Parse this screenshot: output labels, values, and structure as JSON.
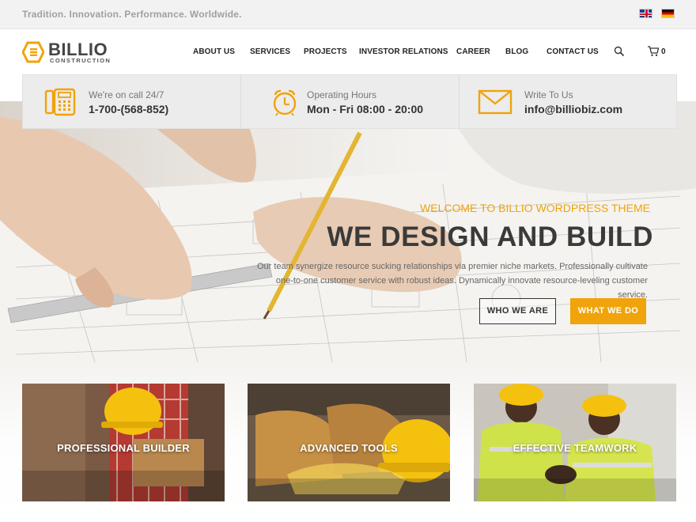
{
  "topbar": {
    "tagline": "Tradition. Innovation. Performance. Worldwide.",
    "languages": [
      {
        "name": "English",
        "icon": "uk-flag-icon"
      },
      {
        "name": "German",
        "icon": "germany-flag-icon"
      }
    ]
  },
  "header": {
    "logo": {
      "name": "BILLIO",
      "sub": "CONSTRUCTION"
    },
    "nav": [
      "ABOUT US",
      "SERVICES",
      "PROJECTS",
      "INVESTOR RELATIONS",
      "CAREER",
      "BLOG",
      "CONTACT US"
    ],
    "cart_count": "0"
  },
  "infobar": {
    "phone": {
      "label": "We're on call 24/7",
      "value": "1-700-(568-852)",
      "icon": "phone-icon"
    },
    "hours": {
      "label": "Operating Hours",
      "value": "Mon - Fri 08:00 - 20:00",
      "icon": "alarm-clock-icon"
    },
    "email": {
      "label": "Write To Us",
      "value": "info@billiobiz.com",
      "icon": "envelope-icon"
    }
  },
  "hero": {
    "kicker": "WELCOME TO BILLIO WORDPRESS THEME",
    "title": "WE DESIGN AND BUILD",
    "description": "Our team synergize resource sucking relationships via premier niche markets. Professionally cultivate one-to-one customer service with robust ideas. Dynamically innovate resource-leveling customer service.",
    "buttons": {
      "primary": "WHO WE ARE",
      "secondary": "WHAT WE DO"
    }
  },
  "cards": [
    {
      "title": "PROFESSIONAL BUILDER"
    },
    {
      "title": "ADVANCED TOOLS"
    },
    {
      "title": "EFFECTIVE TEAMWORK"
    }
  ],
  "colors": {
    "accent": "#f0a30a",
    "text_dark": "#333333"
  }
}
